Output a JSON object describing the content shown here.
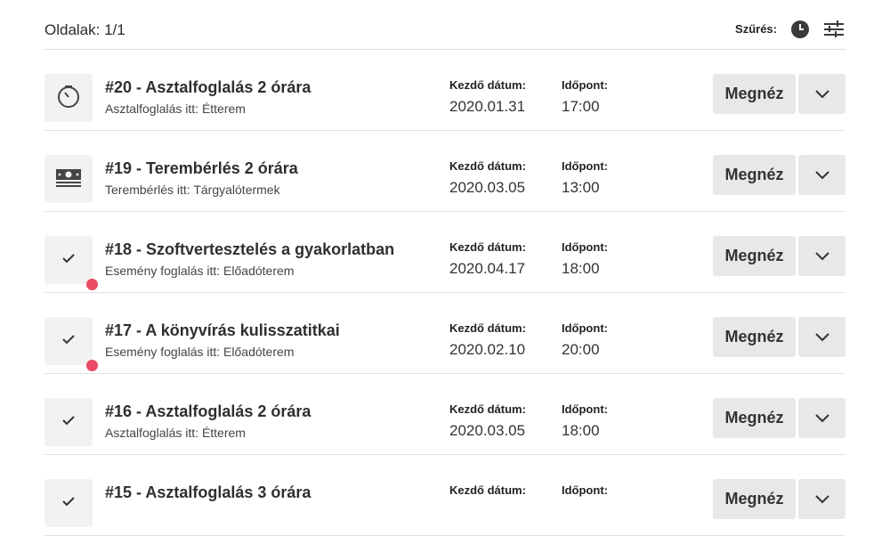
{
  "header": {
    "pages_label": "Oldalak: 1/1",
    "filter_label": "Szűrés:"
  },
  "labels": {
    "start_date": "Kezdő dátum:",
    "time": "Időpont:",
    "view_button": "Megnéz"
  },
  "bookings": [
    {
      "title": "#20 - Asztalfoglalás 2 órára",
      "subtitle": "Asztalfoglalás itt: Étterem",
      "date": "2020.01.31",
      "time": "17:00",
      "icon": "timer-icon",
      "unread": false
    },
    {
      "title": "#19 - Terembérlés 2 órára",
      "subtitle": "Terembérlés itt: Tárgyalótermek",
      "date": "2020.03.05",
      "time": "13:00",
      "icon": "cash-icon",
      "unread": false
    },
    {
      "title": "#18 - Szoftvertesztelés a gyakorlatban",
      "subtitle": "Esemény foglalás itt: Előadóterem",
      "date": "2020.04.17",
      "time": "18:00",
      "icon": "check-icon",
      "unread": true
    },
    {
      "title": "#17 - A könyvírás kulisszatitkai",
      "subtitle": "Esemény foglalás itt: Előadóterem",
      "date": "2020.02.10",
      "time": "20:00",
      "icon": "check-icon",
      "unread": true
    },
    {
      "title": "#16 - Asztalfoglalás 2 órára",
      "subtitle": "Asztalfoglalás itt: Étterem",
      "date": "2020.03.05",
      "time": "18:00",
      "icon": "check-icon",
      "unread": false
    },
    {
      "title": "#15 - Asztalfoglalás 3 órára",
      "subtitle": "",
      "date": "",
      "time": "",
      "icon": "check-icon",
      "unread": false
    }
  ],
  "colors": {
    "accent_dot": "#ea4a63",
    "button_bg": "#e8e8e8",
    "thumb_bg": "#f2f2f2"
  }
}
